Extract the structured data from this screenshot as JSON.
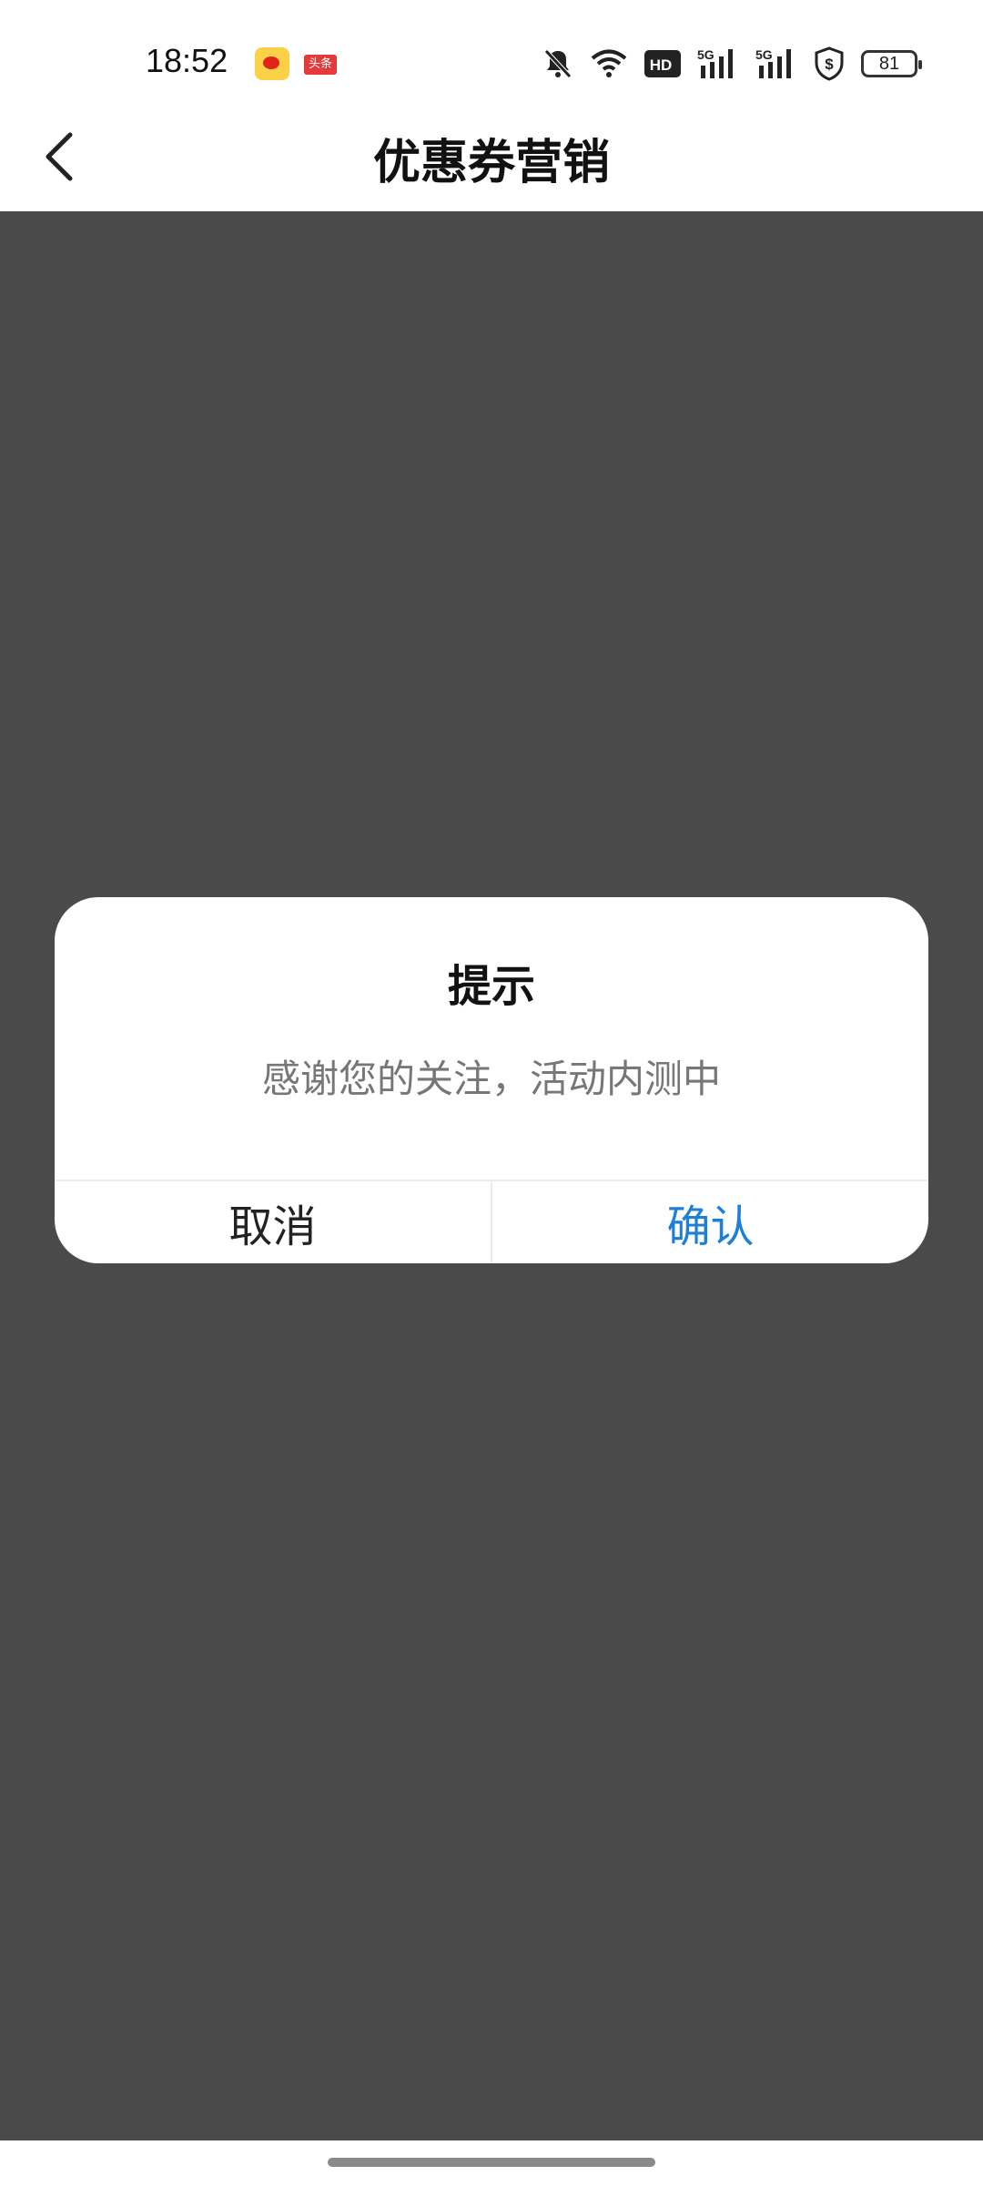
{
  "status_bar": {
    "time": "18:52",
    "notification_icons": [
      "weibo-icon",
      "toutiao-icon"
    ],
    "toutiao_label": "头条",
    "system_icons": [
      "bell-off-icon",
      "wifi-icon",
      "hd-icon",
      "signal-5g-icon",
      "signal-5g-icon",
      "security-shield-icon",
      "battery-icon"
    ],
    "hd_label": "HD",
    "network_label": "5G",
    "battery_level": "81"
  },
  "header": {
    "title": "优惠券营销",
    "back_icon": "chevron-left-icon"
  },
  "dialog": {
    "title": "提示",
    "message": "感谢您的关注，活动内测中",
    "cancel_label": "取消",
    "confirm_label": "确认"
  },
  "colors": {
    "overlay": "#4a4a4a",
    "confirm": "#1e7fd6",
    "dialog_bg": "#ffffff"
  }
}
